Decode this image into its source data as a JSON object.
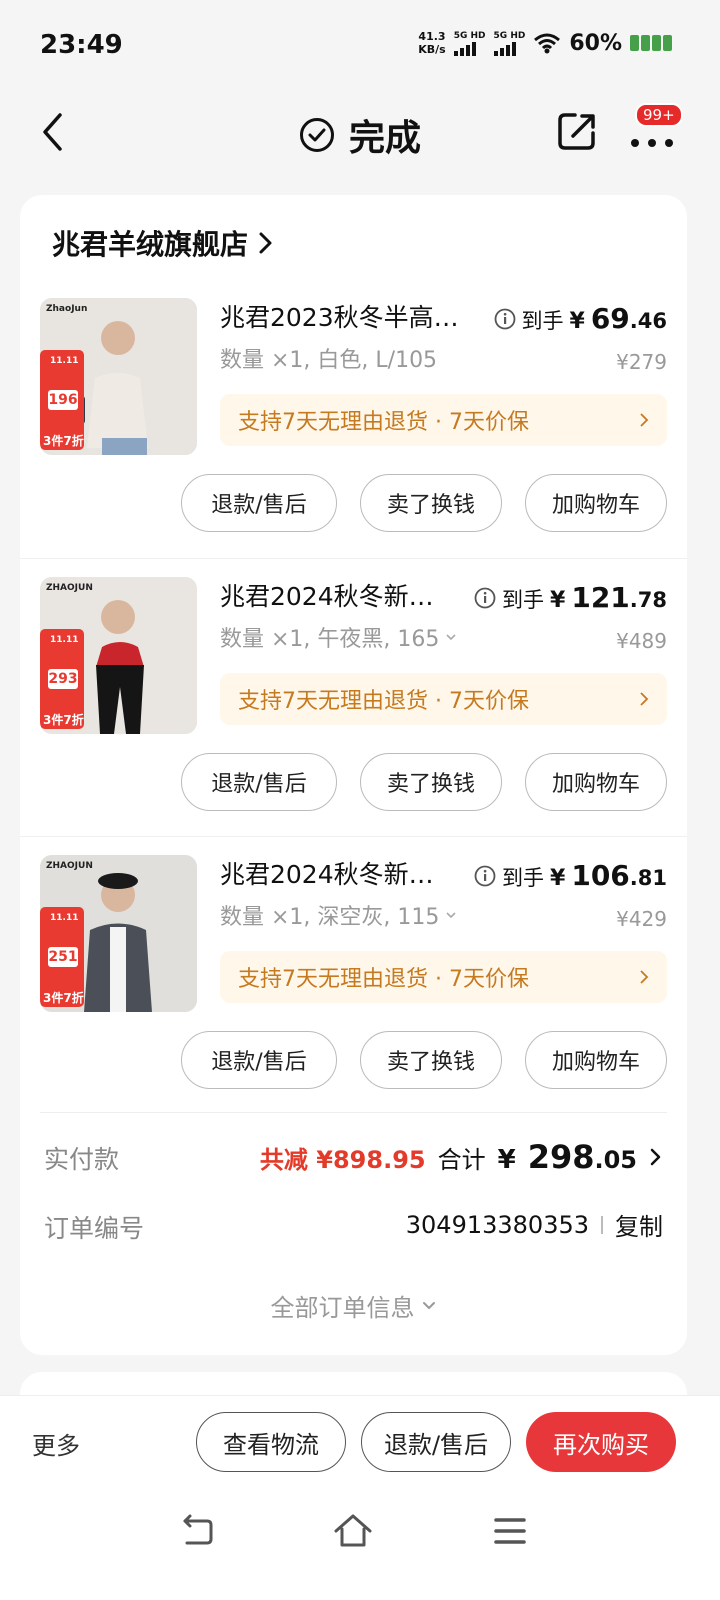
{
  "status_bar": {
    "time": "23:49",
    "net_speed_value": "41.3",
    "net_speed_unit": "KB/s",
    "sim1": "5G HD",
    "sim2": "5G HD",
    "battery": "60%"
  },
  "nav": {
    "title": "完成",
    "badge": "99+"
  },
  "store": {
    "name": "兆君羊绒旗舰店"
  },
  "items": [
    {
      "title": "兆君2023秋冬半高…",
      "spec": "数量 ×1, 白色, L/105",
      "price_label": "到手",
      "price_currency": "¥",
      "price_int": "69",
      "price_dec": ".46",
      "original_price": "¥279",
      "guarantee": "支持7天无理由退货 · 7天价保",
      "thumb_brand": "ZhaoJun",
      "promo_date": "11.11",
      "promo_price": "196",
      "promo_discount": "3件7折",
      "buttons": [
        "退款/售后",
        "卖了换钱",
        "加购物车"
      ]
    },
    {
      "title": "兆君2024秋冬新…",
      "spec": "数量 ×1, 午夜黑, 165",
      "price_label": "到手",
      "price_currency": "¥",
      "price_int": "121",
      "price_dec": ".78",
      "original_price": "¥489",
      "guarantee": "支持7天无理由退货 · 7天价保",
      "thumb_brand": "ZHAOJUN",
      "promo_date": "11.11",
      "promo_price": "293",
      "promo_discount": "3件7折",
      "buttons": [
        "退款/售后",
        "卖了换钱",
        "加购物车"
      ]
    },
    {
      "title": "兆君2024秋冬新…",
      "spec": "数量 ×1, 深空灰, 115",
      "price_label": "到手",
      "price_currency": "¥",
      "price_int": "106",
      "price_dec": ".81",
      "original_price": "¥429",
      "guarantee": "支持7天无理由退货 · 7天价保",
      "thumb_brand": "ZHAOJUN",
      "promo_date": "11.11",
      "promo_price": "251",
      "promo_discount": "3件7折",
      "buttons": [
        "退款/售后",
        "卖了换钱",
        "加购物车"
      ]
    }
  ],
  "summary": {
    "paid_label": "实付款",
    "discount": "共减 ¥898.95",
    "total_label": "合计",
    "total_currency": "¥",
    "total_int": "298",
    "total_dec": ".05",
    "order_label": "订单编号",
    "order_number": "304913380353",
    "copy": "复制",
    "all_info": "全部订单信息"
  },
  "bottom_bar": {
    "more": "更多",
    "logistics": "查看物流",
    "refund": "退款/售后",
    "rebuy": "再次购买"
  },
  "colors": {
    "accent_red": "#e8373a",
    "discount_red": "#e43a2a",
    "guarantee_text": "#c67a20",
    "guarantee_bg": "#fff7ea"
  }
}
